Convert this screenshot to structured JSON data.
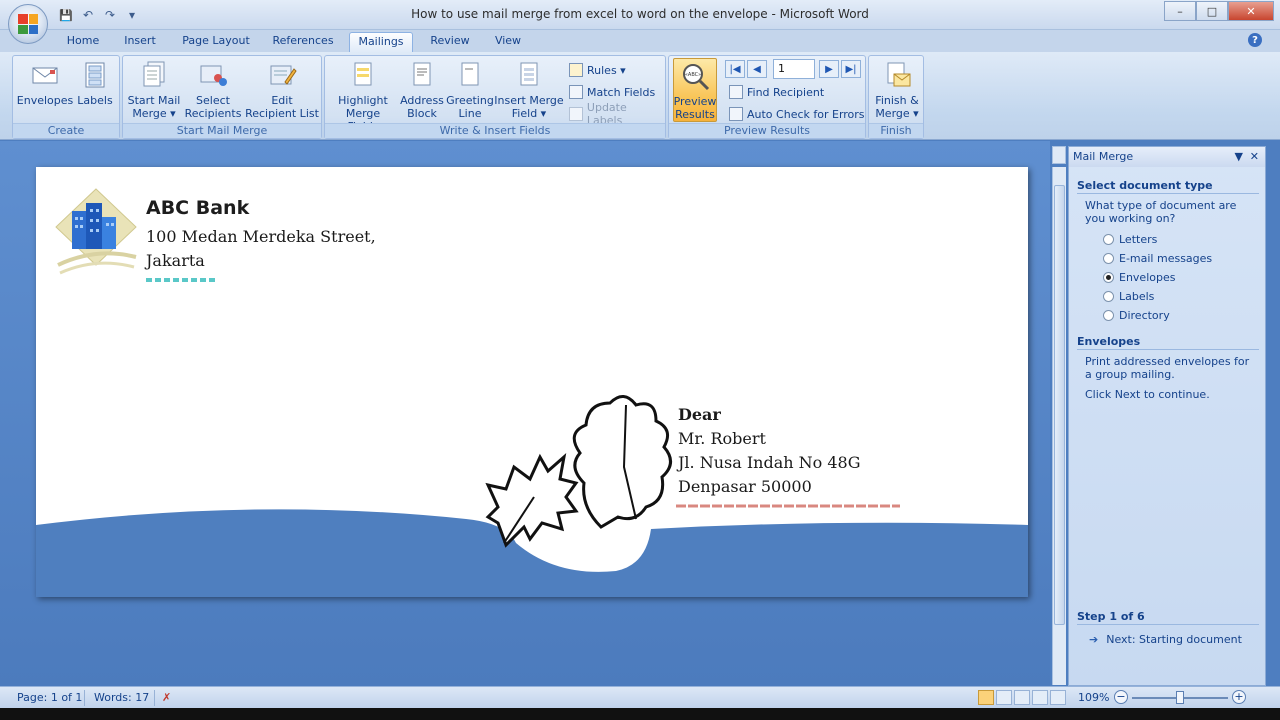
{
  "window": {
    "title": "How to use mail merge from excel to word on the envelope - Microsoft Word",
    "min": "–",
    "max": "□",
    "close": "✕"
  },
  "qat": {
    "save": "💾",
    "undo": "↶",
    "redo": "↷",
    "more": "▾"
  },
  "tabs": [
    "Home",
    "Insert",
    "Page Layout",
    "References",
    "Mailings",
    "Review",
    "View"
  ],
  "active_tab": "Mailings",
  "help": "?",
  "ribbon": {
    "create": {
      "label": "Create",
      "envelopes": "Envelopes",
      "labels": "Labels"
    },
    "start": {
      "label": "Start Mail Merge",
      "start_l1": "Start Mail",
      "start_l2": "Merge ▾",
      "select_l1": "Select",
      "select_l2": "Recipients ▾",
      "edit_l1": "Edit",
      "edit_l2": "Recipient List"
    },
    "write": {
      "label": "Write & Insert Fields",
      "highlight_l1": "Highlight",
      "highlight_l2": "Merge Fields",
      "address_l1": "Address",
      "address_l2": "Block",
      "greeting_l1": "Greeting",
      "greeting_l2": "Line",
      "insert_l1": "Insert Merge",
      "insert_l2": "Field ▾",
      "rules": "Rules ▾",
      "match": "Match Fields",
      "update": "Update Labels"
    },
    "preview": {
      "label": "Preview Results",
      "btn_l1": "Preview",
      "btn_l2": "Results",
      "record": "1",
      "find": "Find Recipient",
      "auto": "Auto Check for Errors",
      "abc": "«ABC»"
    },
    "finish": {
      "label": "Finish",
      "btn_l1": "Finish &",
      "btn_l2": "Merge ▾"
    }
  },
  "envelope": {
    "bank_name": "ABC Bank",
    "return_line1": "100 Medan Merdeka Street,",
    "return_line2": "Jakarta",
    "recipient": {
      "salutation": "Dear",
      "name": "Mr. Robert",
      "street": "Jl. Nusa Indah No 48G",
      "city": "Denpasar 50000"
    }
  },
  "pane": {
    "title": "Mail Merge",
    "menu": "▼",
    "close": "✕",
    "section1": "Select document type",
    "question": "What type of document are you working on?",
    "options": [
      "Letters",
      "E-mail messages",
      "Envelopes",
      "Labels",
      "Directory"
    ],
    "selected": "Envelopes",
    "section2": "Envelopes",
    "desc": "Print addressed envelopes for a group mailing.",
    "instruction": "Click Next to continue.",
    "step": "Step 1 of 6",
    "next": "Next: Starting document"
  },
  "status": {
    "page": "Page: 1 of 1",
    "words": "Words: 17",
    "zoom": "109%",
    "minus": "−",
    "plus": "+"
  },
  "colors": {
    "ribbon": "#c3d7ee",
    "accent": "#15428b",
    "preview_active": "#f9c65a",
    "envelope_wave": "#4f7fbf"
  }
}
